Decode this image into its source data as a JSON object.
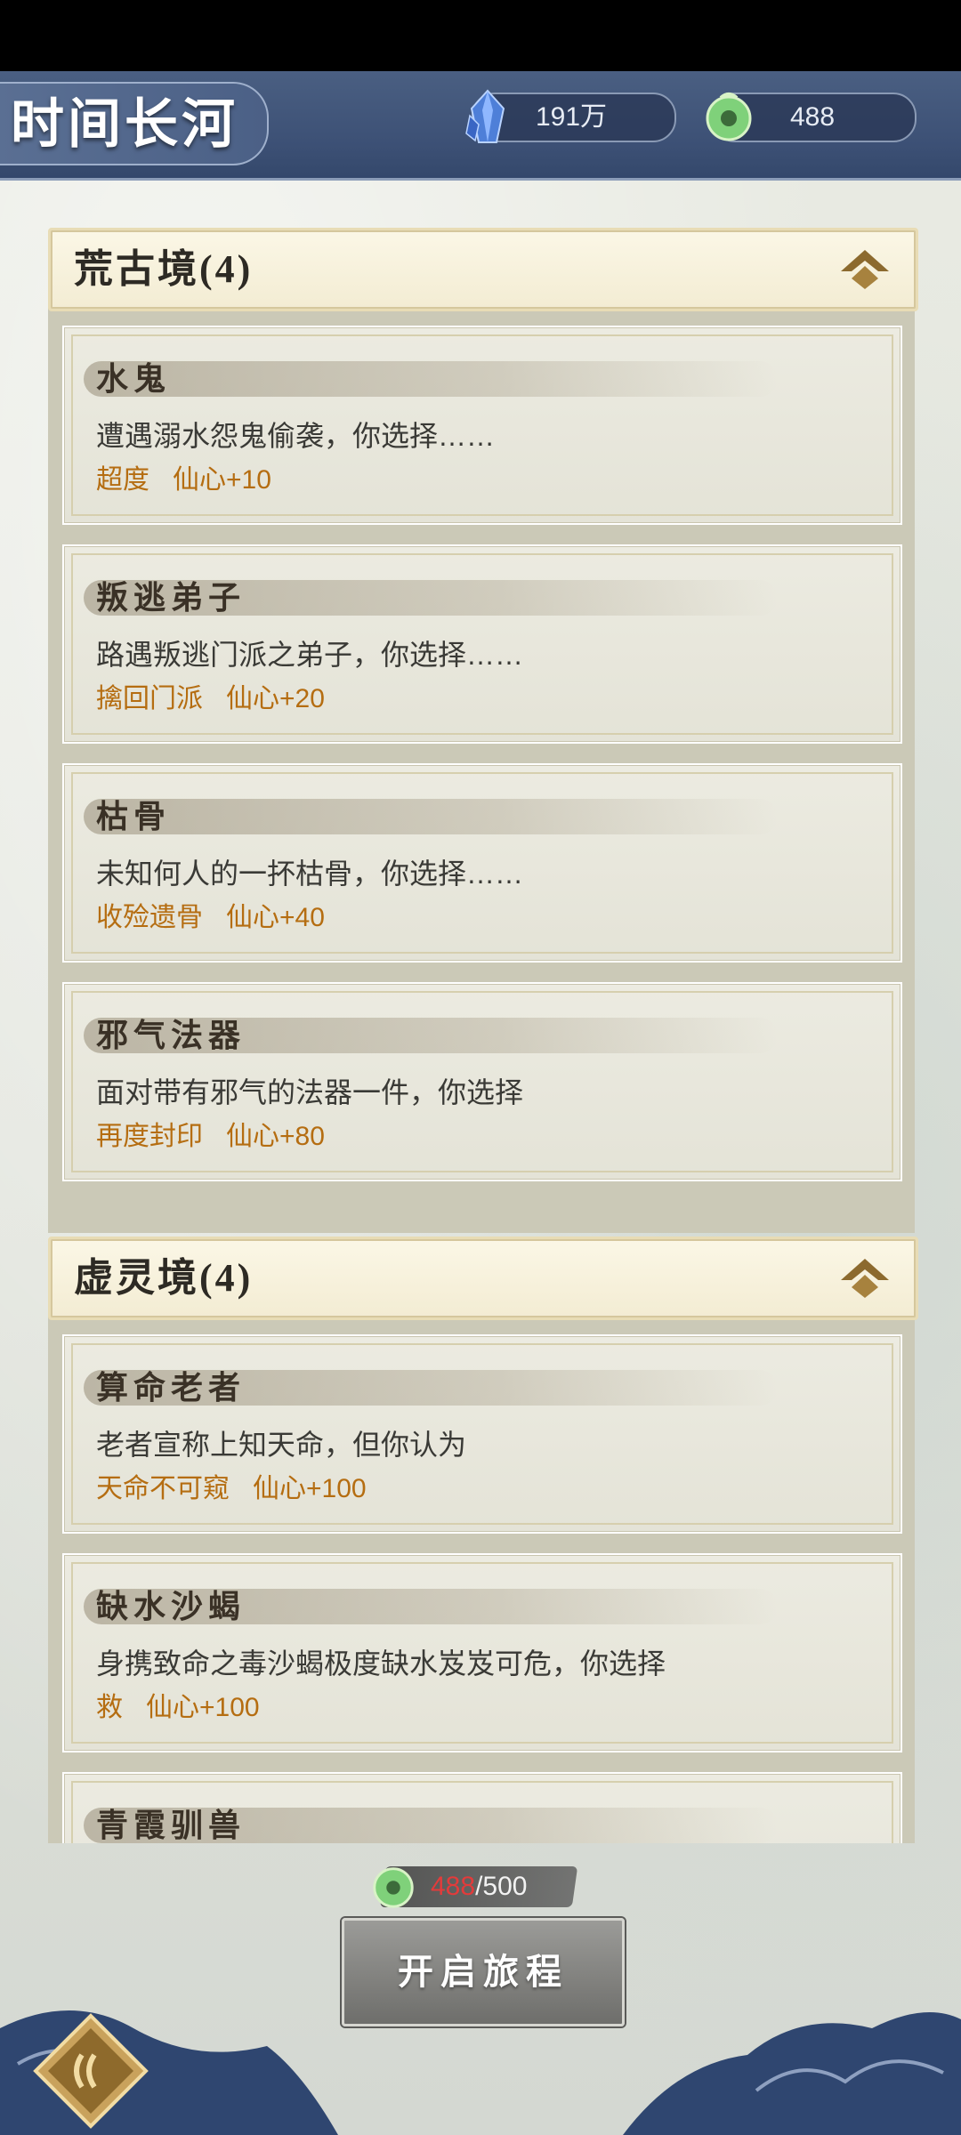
{
  "header": {
    "title": "时间长河",
    "resources": [
      {
        "icon": "crystal-icon",
        "value": "191万"
      },
      {
        "icon": "jade-coin-icon",
        "value": "488"
      }
    ]
  },
  "sections": [
    {
      "title": "荒古境(4)",
      "cards": [
        {
          "title": "水鬼",
          "desc": "遭遇溺水怨鬼偷袭，你选择……",
          "action": "超度",
          "reward": "仙心+10"
        },
        {
          "title": "叛逃弟子",
          "desc": "路遇叛逃门派之弟子，你选择……",
          "action": "擒回门派",
          "reward": "仙心+20"
        },
        {
          "title": "枯骨",
          "desc": "未知何人的一抔枯骨，你选择……",
          "action": "收殓遗骨",
          "reward": "仙心+40"
        },
        {
          "title": "邪气法器",
          "desc": "面对带有邪气的法器一件，你选择",
          "action": "再度封印",
          "reward": "仙心+80"
        }
      ]
    },
    {
      "title": "虚灵境(4)",
      "cards": [
        {
          "title": "算命老者",
          "desc": "老者宣称上知天命，但你认为",
          "action": "天命不可窥",
          "reward": "仙心+100"
        },
        {
          "title": "缺水沙蝎",
          "desc": "身携致命之毒沙蝎极度缺水岌岌可危，你选择",
          "action": "救",
          "reward": "仙心+100"
        },
        {
          "title": "青霞驯兽",
          "desc": "",
          "action": "",
          "reward": ""
        }
      ]
    }
  ],
  "footer": {
    "progress_current": "488",
    "progress_max": "/500",
    "start_label": "开启旅程"
  },
  "colors": {
    "header_bg": "#3c5075",
    "reward_text": "#b56d11",
    "progress_current": "#e23b3b"
  }
}
